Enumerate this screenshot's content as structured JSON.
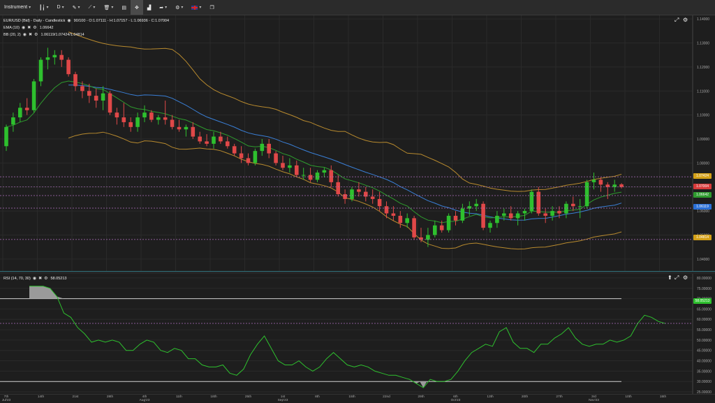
{
  "toolbar": {
    "instrument_label": "Instrument",
    "period_label": "D",
    "items": [
      "bar-type",
      "draw",
      "indicators",
      "templates",
      "screenshot",
      "fullscreen",
      "compare",
      "share",
      "alerts",
      "language",
      "popout"
    ]
  },
  "main": {
    "legend_main": "EUR/USD (Bid) - Daily - Candlestick",
    "legend_ohlc": "90/100 - O:1.07111 - H:1.07157 - L:1.06936 - C:1.07004",
    "ema_label": "EMA (10)",
    "ema_value": "1.06642",
    "bb_label": "BB (20, 2)",
    "bb_value": "1.06119/1.07424/1.04814",
    "price_ticks": [
      "1.14000",
      "1.13000",
      "1.12000",
      "1.11000",
      "1.10000",
      "1.09000",
      "1.08000",
      "1.07000",
      "1.06000",
      "1.05000",
      "1.04000"
    ],
    "tags": {
      "bb_upper": "1.07424",
      "close": "1.07004",
      "ema": "1.06642",
      "bb_mid": "1.06119",
      "bb_lower": "1.04814"
    }
  },
  "rsi": {
    "label": "RSI (14, 70, 30)",
    "value": "58.05213",
    "ticks": [
      "80.00000",
      "75.00000",
      "70.00000",
      "65.00000",
      "60.00000",
      "55.00000",
      "50.00000",
      "45.00000",
      "40.00000",
      "35.00000",
      "30.00000",
      "25.00000"
    ],
    "tag": "58.05213"
  },
  "x_labels": [
    {
      "t": "7th",
      "s": "Jul'23"
    },
    {
      "t": "14th",
      "s": ""
    },
    {
      "t": "21st",
      "s": ""
    },
    {
      "t": "28th",
      "s": ""
    },
    {
      "t": "4th",
      "s": "Aug'23"
    },
    {
      "t": "11th",
      "s": ""
    },
    {
      "t": "18th",
      "s": ""
    },
    {
      "t": "25th",
      "s": ""
    },
    {
      "t": "1st",
      "s": "Sep'23"
    },
    {
      "t": "8th",
      "s": ""
    },
    {
      "t": "15th",
      "s": ""
    },
    {
      "t": "22nd",
      "s": ""
    },
    {
      "t": "29th",
      "s": ""
    },
    {
      "t": "6th",
      "s": "Oct'23"
    },
    {
      "t": "13th",
      "s": ""
    },
    {
      "t": "20th",
      "s": ""
    },
    {
      "t": "27th",
      "s": ""
    },
    {
      "t": "3rd",
      "s": "Nov'23"
    },
    {
      "t": "10th",
      "s": ""
    },
    {
      "t": "15th",
      "s": ""
    }
  ],
  "chart_data": {
    "type": "candlestick",
    "instrument": "EUR/USD (Bid)",
    "ylim": [
      1.035,
      1.1415
    ],
    "candles": [
      [
        1.087,
        1.096,
        1.085,
        1.095
      ],
      [
        1.096,
        1.101,
        1.093,
        1.099
      ],
      [
        1.099,
        1.105,
        1.097,
        1.103
      ],
      [
        1.103,
        1.107,
        1.1,
        1.102
      ],
      [
        1.102,
        1.115,
        1.101,
        1.114
      ],
      [
        1.114,
        1.124,
        1.112,
        1.123
      ],
      [
        1.123,
        1.128,
        1.119,
        1.124
      ],
      [
        1.124,
        1.127,
        1.121,
        1.125
      ],
      [
        1.125,
        1.127,
        1.12,
        1.123
      ],
      [
        1.123,
        1.124,
        1.116,
        1.117
      ],
      [
        1.117,
        1.118,
        1.11,
        1.112
      ],
      [
        1.112,
        1.114,
        1.107,
        1.11
      ],
      [
        1.11,
        1.113,
        1.105,
        1.108
      ],
      [
        1.108,
        1.111,
        1.103,
        1.106
      ],
      [
        1.106,
        1.112,
        1.102,
        1.109
      ],
      [
        1.109,
        1.11,
        1.1,
        1.101
      ],
      [
        1.101,
        1.103,
        1.096,
        1.099
      ],
      [
        1.099,
        1.105,
        1.095,
        1.097
      ],
      [
        1.097,
        1.099,
        1.093,
        1.095
      ],
      [
        1.095,
        1.101,
        1.093,
        1.099
      ],
      [
        1.099,
        1.104,
        1.097,
        1.101
      ],
      [
        1.101,
        1.102,
        1.097,
        1.098
      ],
      [
        1.098,
        1.1,
        1.096,
        1.099
      ],
      [
        1.099,
        1.106,
        1.096,
        1.098
      ],
      [
        1.098,
        1.1,
        1.094,
        1.095
      ],
      [
        1.095,
        1.098,
        1.093,
        1.094
      ],
      [
        1.094,
        1.096,
        1.091,
        1.095
      ],
      [
        1.095,
        1.097,
        1.09,
        1.091
      ],
      [
        1.091,
        1.093,
        1.088,
        1.089
      ],
      [
        1.089,
        1.092,
        1.087,
        1.088
      ],
      [
        1.088,
        1.093,
        1.086,
        1.091
      ],
      [
        1.091,
        1.093,
        1.088,
        1.089
      ],
      [
        1.089,
        1.091,
        1.086,
        1.087
      ],
      [
        1.087,
        1.088,
        1.083,
        1.084
      ],
      [
        1.084,
        1.087,
        1.08,
        1.082
      ],
      [
        1.082,
        1.084,
        1.079,
        1.08
      ],
      [
        1.08,
        1.086,
        1.079,
        1.085
      ],
      [
        1.085,
        1.09,
        1.083,
        1.088
      ],
      [
        1.088,
        1.09,
        1.082,
        1.084
      ],
      [
        1.084,
        1.085,
        1.079,
        1.08
      ],
      [
        1.08,
        1.083,
        1.077,
        1.078
      ],
      [
        1.078,
        1.082,
        1.076,
        1.079
      ],
      [
        1.079,
        1.081,
        1.074,
        1.075
      ],
      [
        1.075,
        1.078,
        1.073,
        1.075
      ],
      [
        1.075,
        1.078,
        1.072,
        1.073
      ],
      [
        1.073,
        1.077,
        1.072,
        1.076
      ],
      [
        1.076,
        1.078,
        1.074,
        1.077
      ],
      [
        1.077,
        1.079,
        1.07,
        1.072
      ],
      [
        1.072,
        1.075,
        1.066,
        1.067
      ],
      [
        1.067,
        1.069,
        1.063,
        1.065
      ],
      [
        1.065,
        1.07,
        1.064,
        1.069
      ],
      [
        1.069,
        1.072,
        1.066,
        1.068
      ],
      [
        1.068,
        1.07,
        1.064,
        1.066
      ],
      [
        1.066,
        1.069,
        1.063,
        1.065
      ],
      [
        1.065,
        1.068,
        1.06,
        1.062
      ],
      [
        1.062,
        1.064,
        1.057,
        1.059
      ],
      [
        1.059,
        1.062,
        1.056,
        1.058
      ],
      [
        1.058,
        1.06,
        1.053,
        1.055
      ],
      [
        1.055,
        1.059,
        1.053,
        1.057
      ],
      [
        1.057,
        1.058,
        1.048,
        1.049
      ],
      [
        1.049,
        1.053,
        1.047,
        1.048
      ],
      [
        1.048,
        1.053,
        1.045,
        1.05
      ],
      [
        1.05,
        1.056,
        1.049,
        1.054
      ],
      [
        1.054,
        1.056,
        1.051,
        1.052
      ],
      [
        1.052,
        1.059,
        1.051,
        1.058
      ],
      [
        1.058,
        1.06,
        1.054,
        1.056
      ],
      [
        1.056,
        1.063,
        1.055,
        1.061
      ],
      [
        1.061,
        1.064,
        1.058,
        1.062
      ],
      [
        1.062,
        1.065,
        1.06,
        1.063
      ],
      [
        1.063,
        1.064,
        1.052,
        1.053
      ],
      [
        1.053,
        1.056,
        1.051,
        1.055
      ],
      [
        1.055,
        1.06,
        1.053,
        1.058
      ],
      [
        1.058,
        1.061,
        1.056,
        1.059
      ],
      [
        1.059,
        1.062,
        1.056,
        1.057
      ],
      [
        1.057,
        1.06,
        1.054,
        1.059
      ],
      [
        1.059,
        1.061,
        1.056,
        1.06
      ],
      [
        1.06,
        1.069,
        1.059,
        1.068
      ],
      [
        1.068,
        1.07,
        1.058,
        1.059
      ],
      [
        1.059,
        1.061,
        1.055,
        1.058
      ],
      [
        1.058,
        1.062,
        1.056,
        1.06
      ],
      [
        1.06,
        1.062,
        1.057,
        1.059
      ],
      [
        1.059,
        1.064,
        1.057,
        1.063
      ],
      [
        1.063,
        1.066,
        1.06,
        1.062
      ],
      [
        1.062,
        1.065,
        1.057,
        1.062
      ],
      [
        1.062,
        1.073,
        1.061,
        1.072
      ],
      [
        1.072,
        1.076,
        1.069,
        1.073
      ],
      [
        1.073,
        1.074,
        1.068,
        1.071
      ],
      [
        1.071,
        1.072,
        1.065,
        1.07
      ],
      [
        1.07,
        1.073,
        1.068,
        1.071
      ],
      [
        1.0711,
        1.0716,
        1.0694,
        1.07
      ]
    ]
  },
  "rsi_chart": {
    "type": "line",
    "ylim": [
      24,
      82
    ],
    "levels": [
      70,
      30
    ],
    "values": [
      76,
      76,
      76,
      75,
      71,
      63,
      61,
      56,
      53,
      49,
      50,
      49,
      50,
      49,
      45,
      45,
      48,
      50,
      49,
      45,
      44,
      46,
      45,
      41,
      41,
      38,
      37,
      37,
      38,
      34,
      33,
      36,
      43,
      48,
      52,
      46,
      40,
      38,
      38,
      40,
      37,
      35,
      37,
      41,
      44,
      41,
      38,
      37,
      38,
      37,
      35,
      34,
      33,
      33,
      32,
      31,
      29,
      27,
      31,
      30,
      30,
      31,
      35,
      40,
      44,
      46,
      48,
      47,
      54,
      56,
      49,
      46,
      46,
      44,
      48,
      48,
      51,
      53,
      56,
      51,
      48,
      47,
      48,
      48,
      50,
      49,
      50,
      52,
      58,
      62,
      61,
      59,
      58
    ]
  }
}
